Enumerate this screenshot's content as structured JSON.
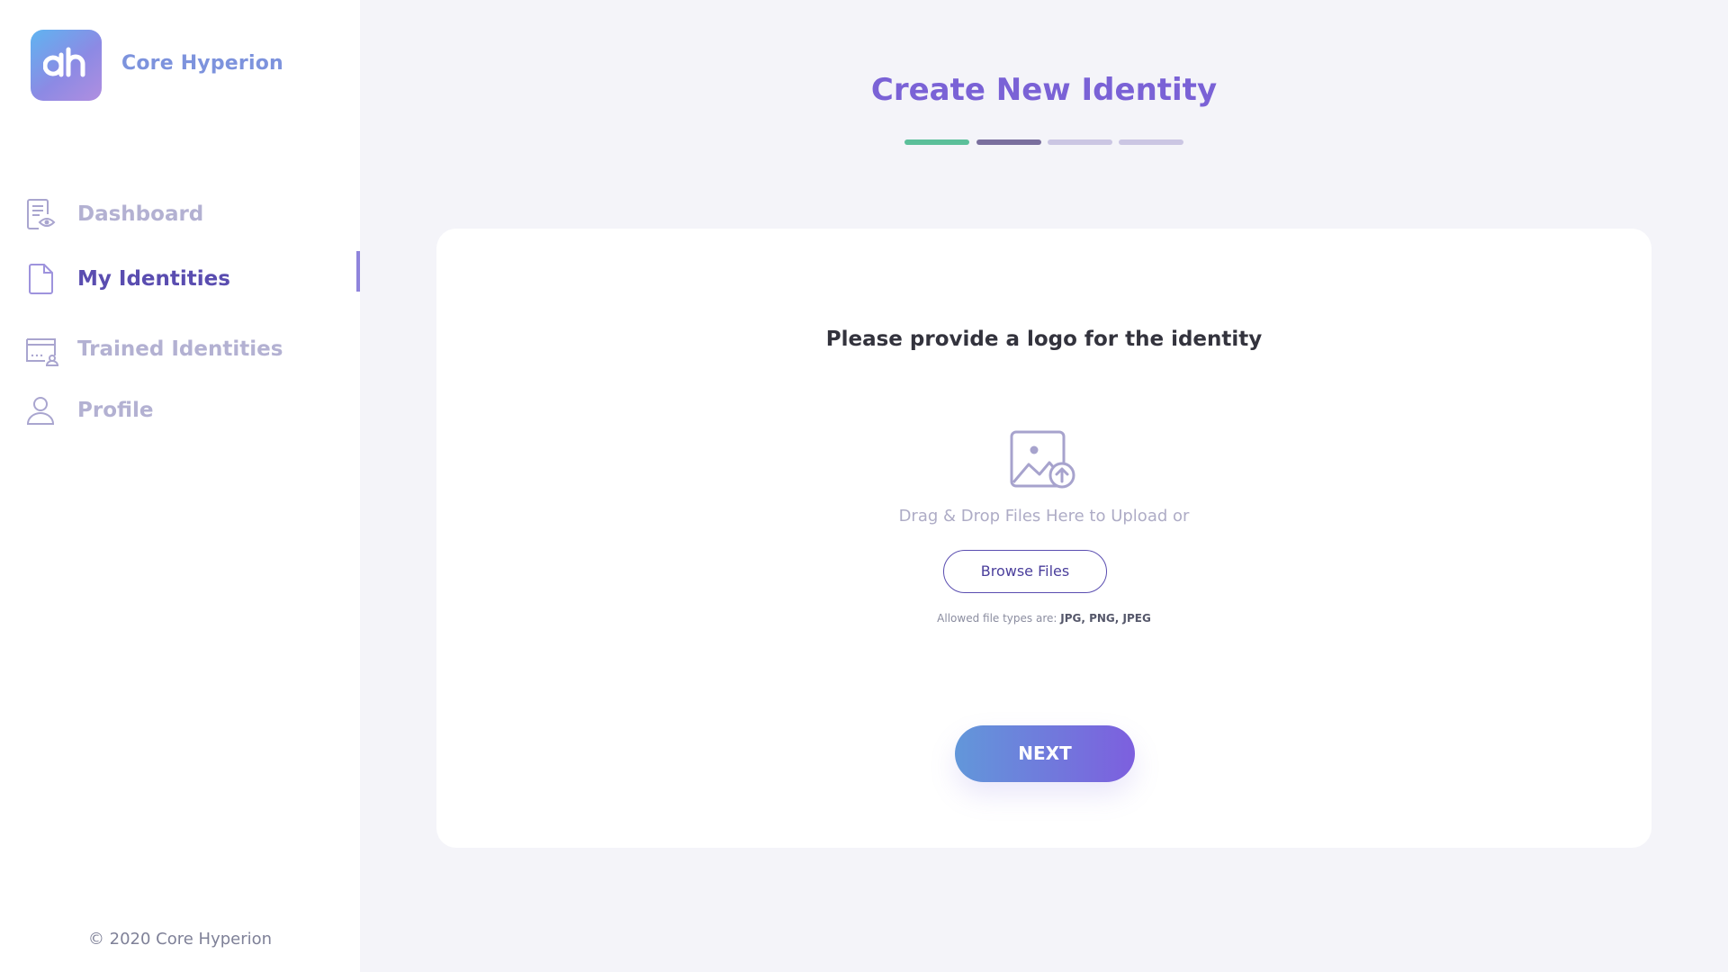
{
  "sidebar": {
    "brand_name": "Core Hyperion",
    "items": [
      {
        "label": "Dashboard",
        "icon": "dashboard-icon",
        "active": false
      },
      {
        "label": "My Identities",
        "icon": "document-icon",
        "active": true
      },
      {
        "label": "Trained Identities",
        "icon": "trained-identities-icon",
        "active": false
      },
      {
        "label": "Profile",
        "icon": "user-icon",
        "active": false
      }
    ],
    "copyright": "© 2020 Core Hyperion"
  },
  "main": {
    "title": "Create New Identity",
    "steps": [
      {
        "state": "complete",
        "color": "#5bbf9a"
      },
      {
        "state": "current",
        "color": "#7a6f9e"
      },
      {
        "state": "pending",
        "color": "#cbc6e3"
      },
      {
        "state": "pending",
        "color": "#cbc6e3"
      }
    ],
    "card": {
      "prompt": "Please provide a logo for the identity",
      "upload_icon": "image-upload-icon",
      "drag_drop_text": "Drag & Drop Files Here to Upload or",
      "browse_label": "Browse Files",
      "allowed_prefix": "Allowed file types are:",
      "allowed_types": "JPG, PNG, JPEG",
      "next_label": "NEXT"
    }
  },
  "colors": {
    "accent": "#7a62d6",
    "active_nav": "#5a4db0",
    "inactive_nav": "#b3b1d2",
    "background": "#f4f4f9"
  }
}
